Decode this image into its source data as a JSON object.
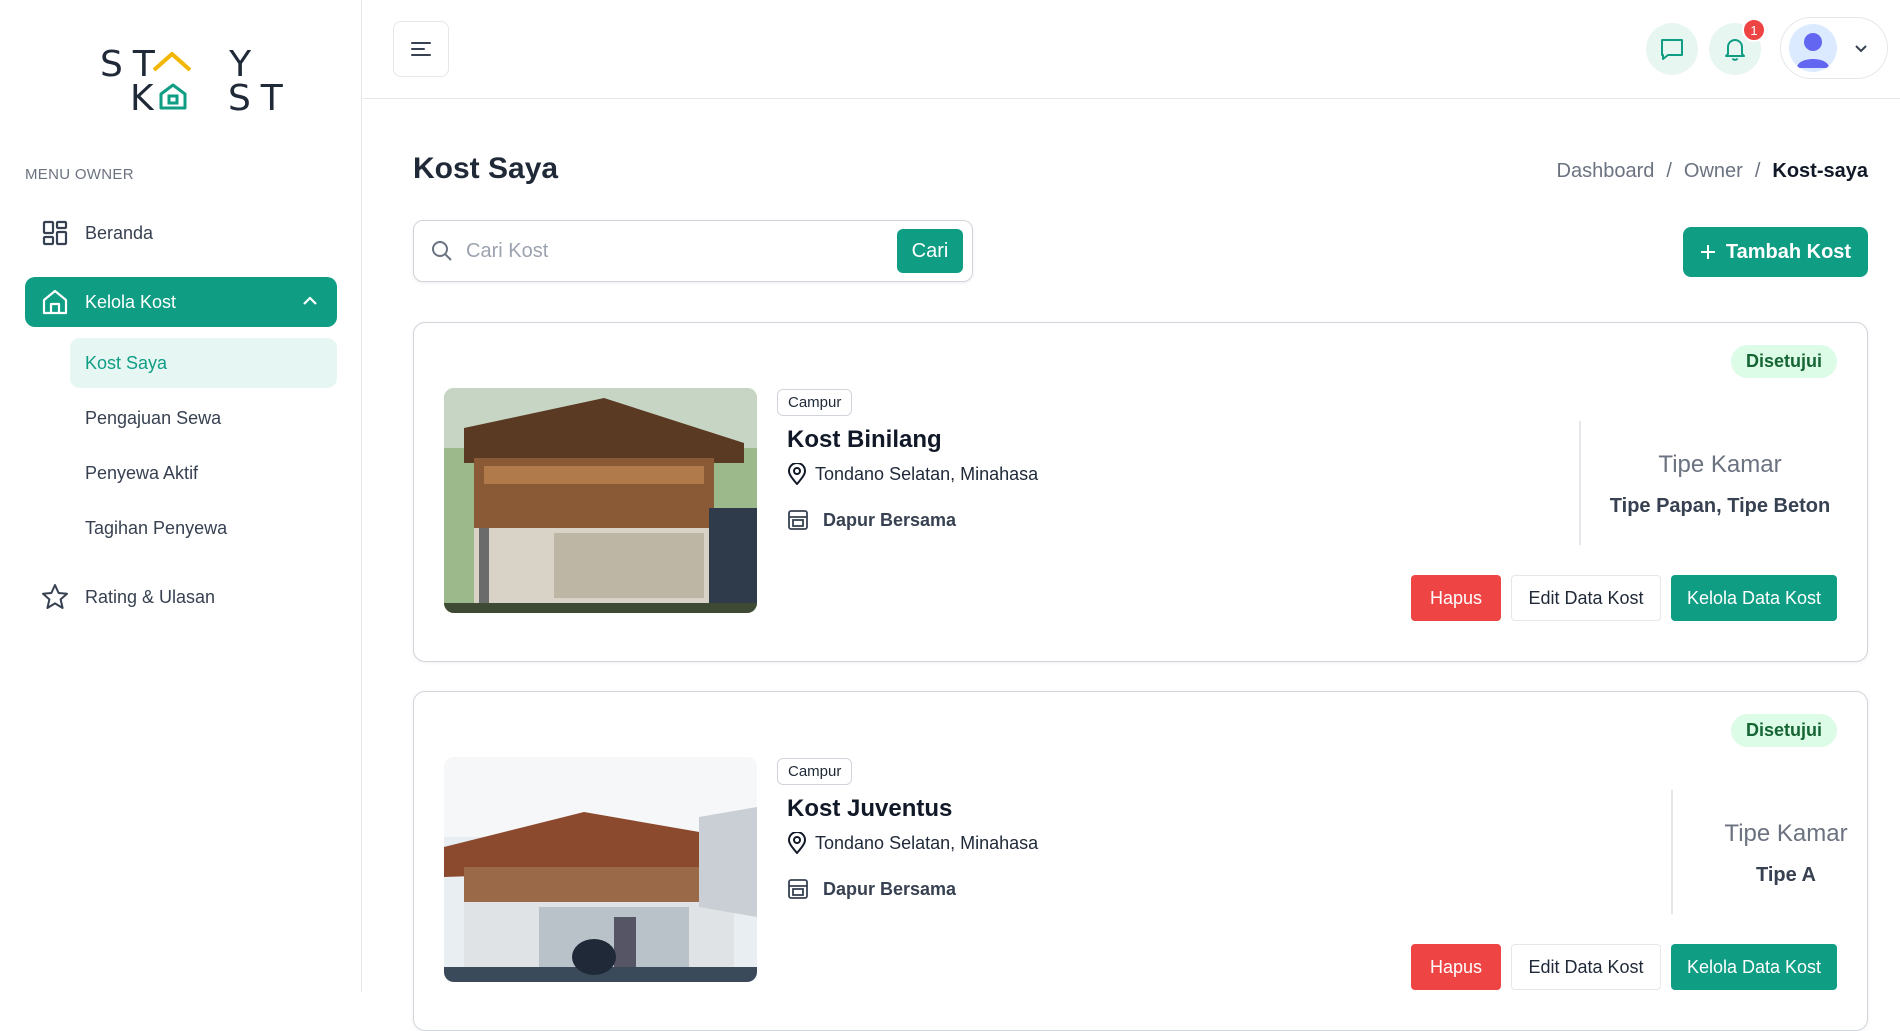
{
  "brand": {
    "logo_row1": "ST Y",
    "logo_row2": "K  ST"
  },
  "sidebar": {
    "menu_title": "MENU OWNER",
    "items": [
      {
        "label": "Beranda",
        "icon": "dashboard-grid-icon"
      },
      {
        "label": "Kelola Kost",
        "icon": "home-icon",
        "active": true
      },
      {
        "label": "Rating & Ulasan",
        "icon": "star-icon"
      }
    ],
    "sub_items": [
      {
        "label": "Kost Saya",
        "active": true
      },
      {
        "label": "Pengajuan Sewa"
      },
      {
        "label": "Penyewa Aktif"
      },
      {
        "label": "Tagihan Penyewa"
      }
    ]
  },
  "header": {
    "notification_count": "1"
  },
  "main": {
    "title": "Kost Saya",
    "breadcrumb": [
      "Dashboard",
      "/",
      "Owner",
      "/",
      "Kost-saya"
    ],
    "search": {
      "placeholder": "Cari Kost",
      "button_label": "Cari"
    },
    "add_button_label": "Tambah Kost"
  },
  "listings": [
    {
      "status": "Disetujui",
      "category": "Campur",
      "name": "Kost Binilang",
      "location": "Tondano Selatan, Minahasa",
      "facility": "Dapur Bersama",
      "room_type_label": "Tipe Kamar",
      "room_types": "Tipe Papan, Tipe Beton",
      "actions": {
        "delete": "Hapus",
        "edit": "Edit Data Kost",
        "manage": "Kelola Data Kost"
      }
    },
    {
      "status": "Disetujui",
      "category": "Campur",
      "name": "Kost Juventus",
      "location": "Tondano Selatan, Minahasa",
      "facility": "Dapur Bersama",
      "room_type_label": "Tipe Kamar",
      "room_types": "Tipe A",
      "actions": {
        "delete": "Hapus",
        "edit": "Edit Data Kost",
        "manage": "Kelola Data Kost"
      }
    }
  ],
  "colors": {
    "primary": "#0f9d84",
    "danger": "#ef4444",
    "success_bg": "#dcfce7"
  }
}
